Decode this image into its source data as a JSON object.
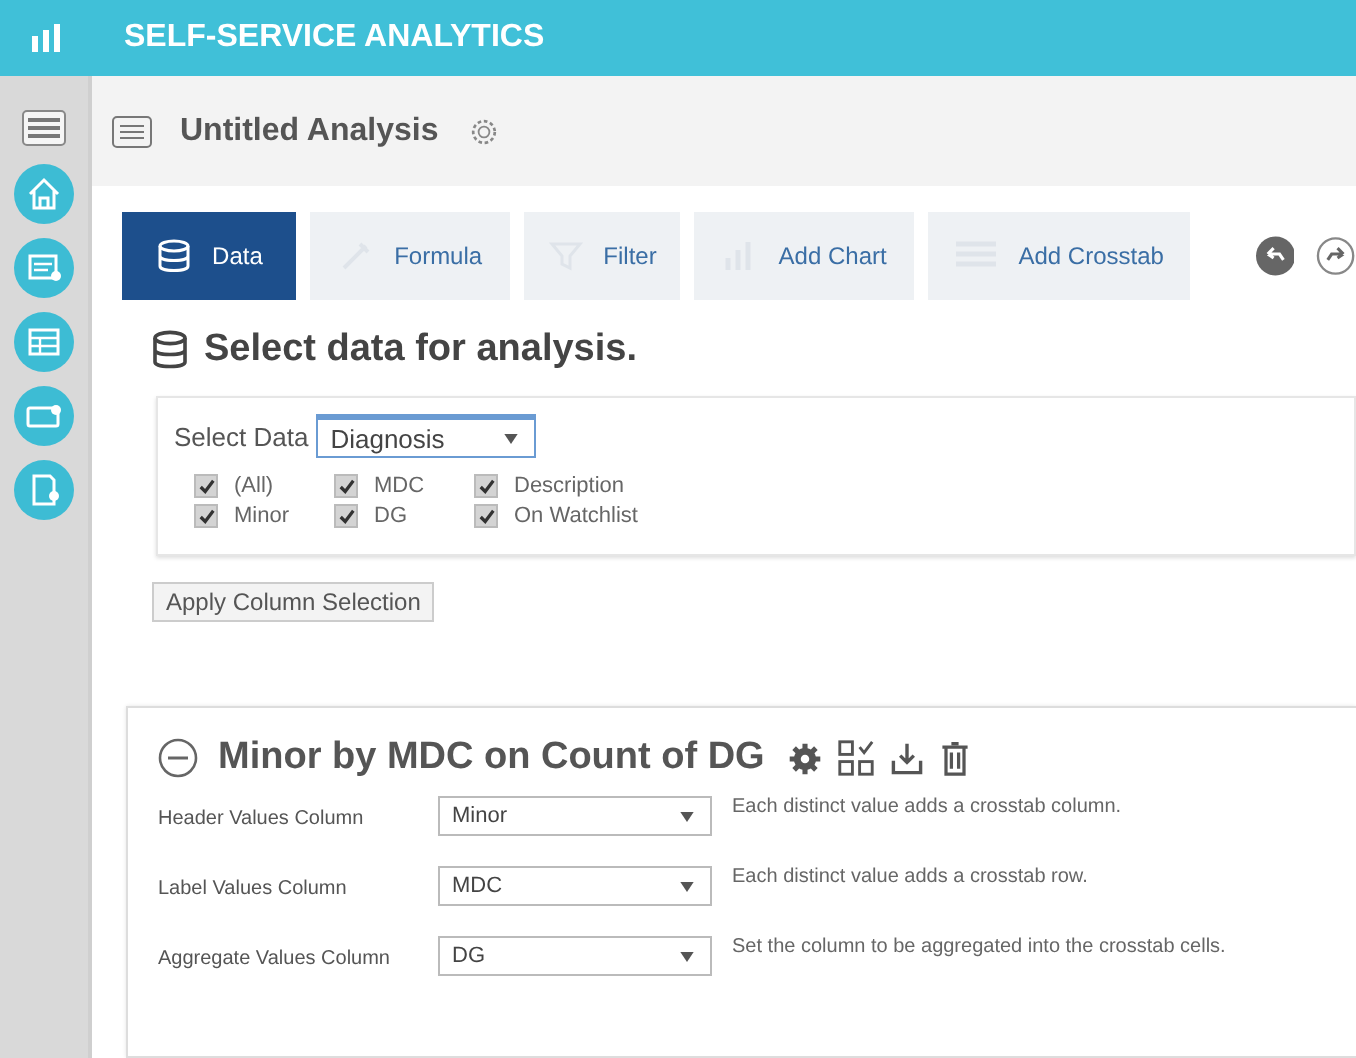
{
  "app": {
    "title": "SELF-SERVICE ANALYTICS"
  },
  "analysis": {
    "title": "Untitled Analysis"
  },
  "tabs": [
    {
      "label": "Data",
      "selected": true,
      "kind": "data"
    },
    {
      "label": "Formula",
      "selected": false,
      "kind": "formula"
    },
    {
      "label": "Filter",
      "selected": false,
      "kind": "filter"
    },
    {
      "label": "Add Chart",
      "selected": false,
      "kind": "chart"
    },
    {
      "label": "Add Crosstab",
      "selected": false,
      "kind": "crosstab"
    }
  ],
  "select_data": {
    "heading": "Select data for analysis.",
    "label": "Select Data",
    "value": "Diagnosis",
    "columns": [
      {
        "label": "(All)",
        "checked": true
      },
      {
        "label": "MDC",
        "checked": true
      },
      {
        "label": "Description",
        "checked": true
      },
      {
        "label": "Minor",
        "checked": true
      },
      {
        "label": "DG",
        "checked": true
      },
      {
        "label": "On Watchlist",
        "checked": true
      }
    ],
    "apply_button": "Apply Column Selection"
  },
  "crosstab": {
    "title": "Minor by MDC on Count of DG",
    "expanded": true,
    "fields": [
      {
        "label": "Header Values Column",
        "value": "Minor",
        "hint": "Each distinct value adds a crosstab column."
      },
      {
        "label": "Label Values Column",
        "value": "MDC",
        "hint": "Each distinct value adds a crosstab row."
      },
      {
        "label": "Aggregate Values Column",
        "value": "DG",
        "hint": "Set the column to be aggregated into the crosstab cells."
      }
    ]
  }
}
